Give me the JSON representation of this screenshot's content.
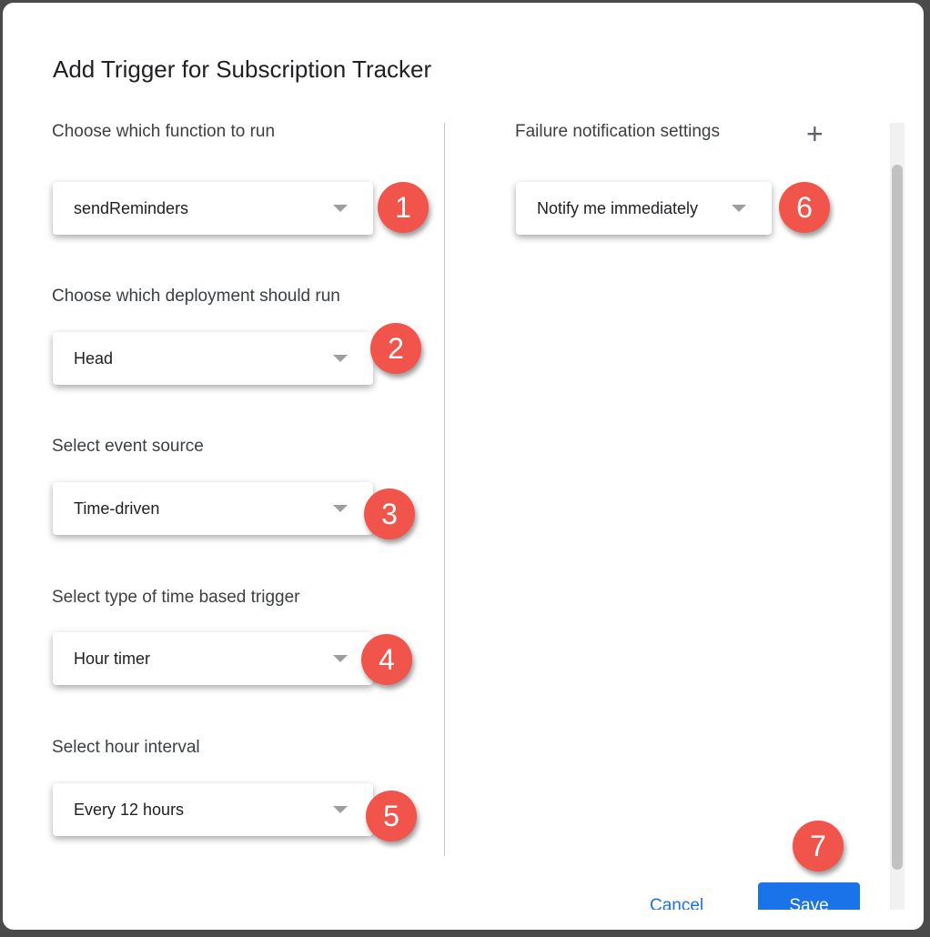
{
  "dialog": {
    "title": "Add Trigger for Subscription Tracker"
  },
  "left": {
    "fields": [
      {
        "label": "Choose which function to run",
        "value": "sendReminders",
        "badge": "1"
      },
      {
        "label": "Choose which deployment should run",
        "value": "Head",
        "badge": "2"
      },
      {
        "label": "Select event source",
        "value": "Time-driven",
        "badge": "3"
      },
      {
        "label": "Select type of time based trigger",
        "value": "Hour timer",
        "badge": "4"
      },
      {
        "label": "Select hour interval",
        "value": "Every 12 hours",
        "badge": "5"
      }
    ]
  },
  "right": {
    "label": "Failure notification settings",
    "add_icon": "plus-icon",
    "value": "Notify me immediately",
    "badge": "6"
  },
  "footer": {
    "cancel": "Cancel",
    "save": "Save",
    "badge": "7"
  },
  "colors": {
    "accent": "#1a73e8",
    "badge": "#f0544a"
  }
}
